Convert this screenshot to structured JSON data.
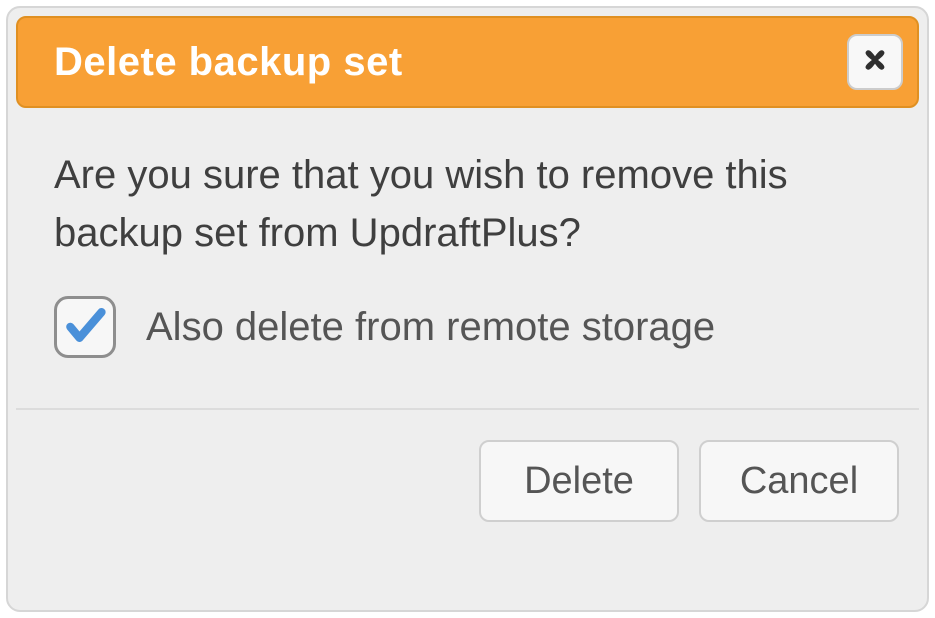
{
  "dialog": {
    "title": "Delete backup set",
    "message": "Are you sure that you wish to remove this backup set from UpdraftPlus?",
    "checkbox": {
      "checked": true,
      "label": "Also delete from remote storage"
    },
    "buttons": {
      "delete": "Delete",
      "cancel": "Cancel"
    }
  },
  "colors": {
    "accent": "#f8a035",
    "check": "#4a90d9"
  }
}
